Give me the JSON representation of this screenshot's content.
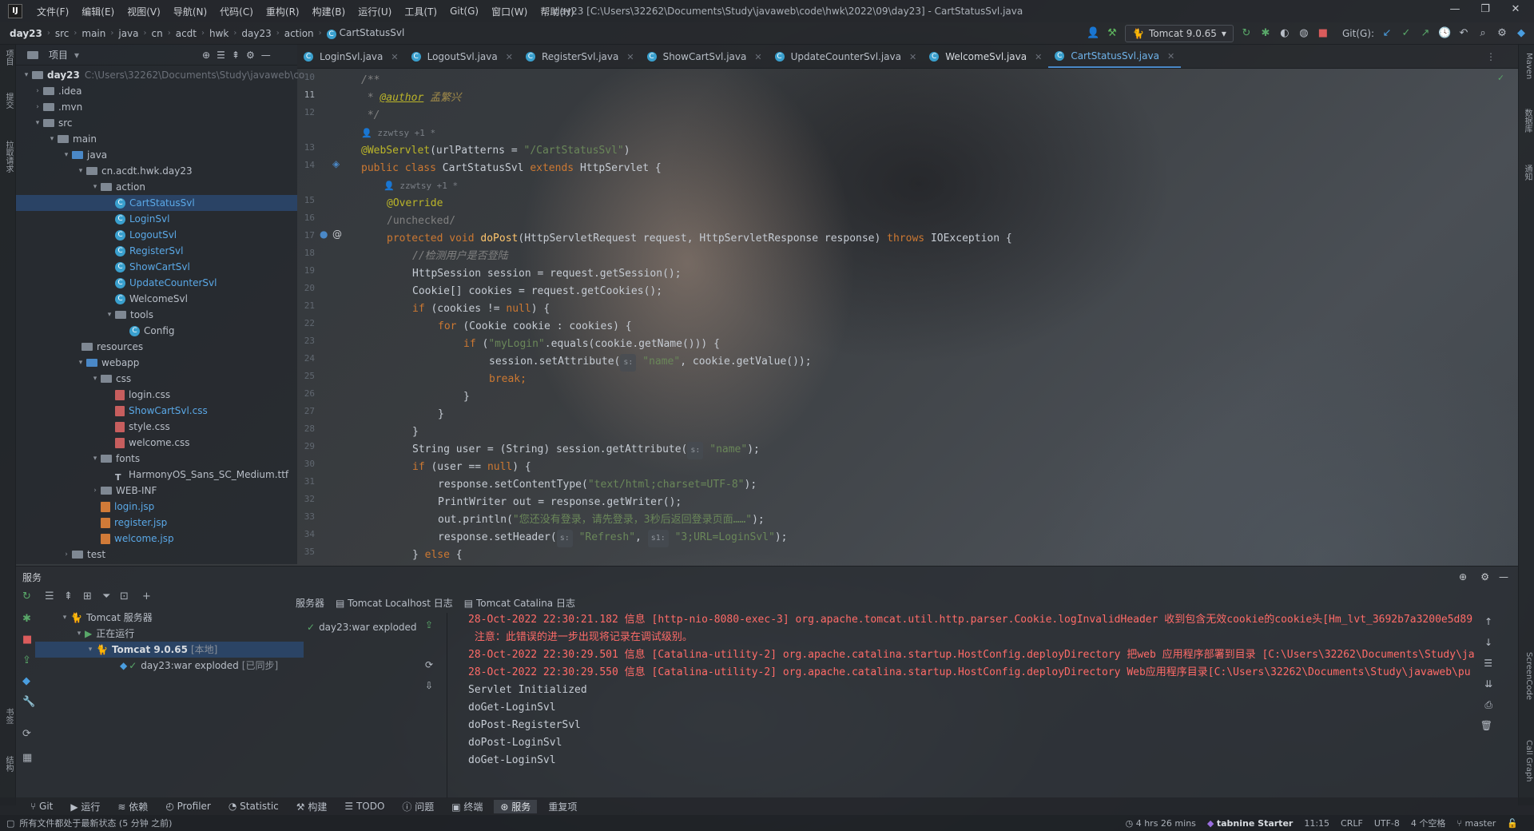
{
  "menubar": {
    "items": [
      "文件(F)",
      "编辑(E)",
      "视图(V)",
      "导航(N)",
      "代码(C)",
      "重构(R)",
      "构建(B)",
      "运行(U)",
      "工具(T)",
      "Git(G)",
      "窗口(W)",
      "帮助(H)"
    ],
    "window_title": "day23 [C:\\Users\\32262\\Documents\\Study\\javaweb\\code\\hwk\\2022\\09\\day23] - CartStatusSvl.java"
  },
  "breadcrumbs": [
    "day23",
    "src",
    "main",
    "java",
    "cn",
    "acdt",
    "hwk",
    "day23",
    "action",
    "CartStatusSvl"
  ],
  "toolbar": {
    "run_config": "Tomcat 9.0.65",
    "git_label": "Git(G):"
  },
  "project": {
    "title": "项目",
    "root": "day23",
    "root_path": "C:\\Users\\32262\\Documents\\Study\\javaweb\\co",
    "tree": [
      ".idea",
      ".mvn",
      "src",
      "main",
      "java",
      "cn.acdt.hwk.day23",
      "action",
      "CartStatusSvl",
      "LoginSvl",
      "LogoutSvl",
      "RegisterSvl",
      "ShowCartSvl",
      "UpdateCounterSvl",
      "WelcomeSvl",
      "tools",
      "Config",
      "resources",
      "webapp",
      "css",
      "login.css",
      "ShowCartSvl.css",
      "style.css",
      "welcome.css",
      "fonts",
      "HarmonyOS_Sans_SC_Medium.ttf",
      "WEB-INF",
      "login.jsp",
      "register.jsp",
      "welcome.jsp",
      "test"
    ]
  },
  "editor": {
    "tabs": [
      "LoginSvl.java",
      "LogoutSvl.java",
      "RegisterSvl.java",
      "ShowCartSvl.java",
      "UpdateCounterSvl.java",
      "WelcomeSvl.java",
      "CartStatusSvl.java"
    ],
    "line_numbers": [
      "10",
      "11",
      "12",
      "",
      "13",
      "14",
      "",
      "15",
      "16",
      "17",
      "18",
      "19",
      "20",
      "21",
      "22",
      "23",
      "24",
      "25",
      "26",
      "27",
      "28",
      "29",
      "30",
      "31",
      "32",
      "33",
      "34",
      "35"
    ],
    "author_hint": "zzwtsy +1 *",
    "hint_s": "s:",
    "hint_s1": "s1:",
    "code": {
      "c10": "/**",
      "c11a": " * ",
      "c11b": "@author",
      "c11c": " 孟繁兴",
      "c12": " */",
      "c13a": "@WebServlet",
      "c13b": "(urlPatterns = ",
      "c13c": "\"/CartStatusSvl\"",
      "c13d": ")",
      "c14a": "public class ",
      "c14b": "CartStatusSvl ",
      "c14c": "extends ",
      "c14d": "HttpServlet {",
      "c15": "@Override",
      "c16": "/unchecked/",
      "c17a": "protected void ",
      "c17b": "doPost",
      "c17c": "(HttpServletRequest request, HttpServletResponse response) ",
      "c17d": "throws ",
      "c17e": "IOException {",
      "c18": "//检测用户是否登陆",
      "c19": "HttpSession session = request.getSession();",
      "c20": "Cookie[] cookies = request.getCookies();",
      "c21a": "if ",
      "c21b": "(cookies != ",
      "c21c": "null",
      ") {": ") {",
      "c21d": ") {",
      "c22a": "for ",
      "c22b": "(Cookie cookie : cookies) {",
      "c23a": "if ",
      "c23b": "(",
      "c23c": "\"myLogin\"",
      "c23d": ".equals(cookie.getName())) {",
      "c24a": "session.setAttribute(",
      "c24b": "\"name\"",
      "c24c": ", cookie.getValue());",
      "c25": "break;",
      "c26": "}",
      "c27": "}",
      "c28": "}",
      "c29a": "String user = (String) session.getAttribute(",
      "c29b": "\"name\"",
      "c29c": ");",
      "c30a": "if ",
      "c30b": "(user == ",
      "c30c": "null",
      "c30d": ") {",
      "c31a": "response.setContentType(",
      "c31b": "\"text/html;charset=UTF-8\"",
      "c31c": ");",
      "c32": "PrintWriter out = response.getWriter();",
      "c33a": "out.println(",
      "c33b": "\"您还没有登录，请先登录，3秒后返回登录页面……\"",
      "c33c": ");",
      "c34a": "response.setHeader(",
      "c34b": "\"Refresh\"",
      "c34c": ", ",
      "c34d": "\"3;URL=LoginSvl\"",
      "c34e": ");",
      "c35a": "} ",
      "c35b": "else ",
      "c35c": "{"
    }
  },
  "services": {
    "title": "服务",
    "tree_root": "Tomcat 服务器",
    "running": "正在运行",
    "server": "Tomcat 9.0.65",
    "server_tag": "[本地]",
    "artifact": "day23:war exploded",
    "artifact_tag": "[已同步]",
    "tabs": [
      "服务器",
      "Tomcat Localhost 日志",
      "Tomcat Catalina 日志"
    ],
    "deployment": "day23:war exploded",
    "console": [
      "28-Oct-2022 22:30:21.182 信息 [http-nio-8080-exec-3] org.apache.tomcat.util.http.parser.Cookie.logInvalidHeader 收到包含无效cookie的cookie头[Hm_lvt_3692b7a3200e5d89",
      " 注意：此错误的进一步出现将记录在调试级别。",
      "28-Oct-2022 22:30:29.501 信息 [Catalina-utility-2] org.apache.catalina.startup.HostConfig.deployDirectory 把web 应用程序部署到目录 [C:\\Users\\32262\\Documents\\Study\\ja",
      "28-Oct-2022 22:30:29.550 信息 [Catalina-utility-2] org.apache.catalina.startup.HostConfig.deployDirectory Web应用程序目录[C:\\Users\\32262\\Documents\\Study\\javaweb\\pu",
      "Servlet Initialized",
      "doGet-LoginSvl",
      "doPost-RegisterSvl",
      "doPost-LoginSvl",
      "doGet-LoginSvl"
    ]
  },
  "bottom_tabs": [
    "Git",
    "运行",
    "依赖",
    "Profiler",
    "Statistic",
    "构建",
    "TODO",
    "问题",
    "终端",
    "服务",
    "重复项"
  ],
  "statusbar": {
    "message": "所有文件都处于最新状态 (5 分钟 之前)",
    "timer": "4 hrs 26 mins",
    "tabnine": "tabnine Starter",
    "position": "11:15",
    "line_sep": "CRLF",
    "encoding": "UTF-8",
    "indent": "4 个空格",
    "branch": "master"
  },
  "left_strip": [
    "项目",
    "提交",
    "拉取请求",
    "书签",
    "结构"
  ],
  "right_strip": [
    "Maven",
    "数据库",
    "通知",
    "ScreenCode",
    "Call Graph"
  ]
}
